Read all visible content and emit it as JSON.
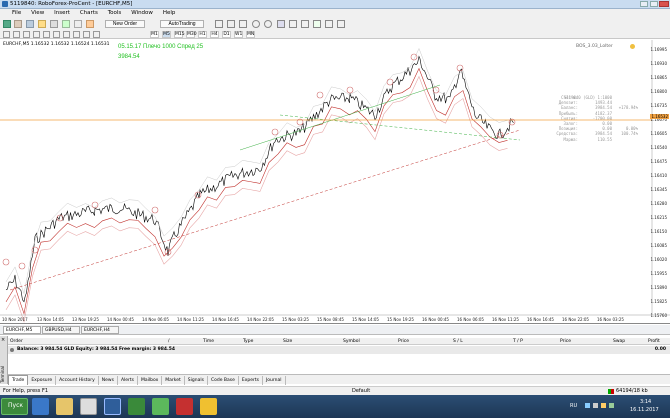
{
  "window": {
    "title": "5119840: RoboForex-ProCent - [EURCHF,M5]"
  },
  "menu": [
    "File",
    "View",
    "Insert",
    "Charts",
    "Tools",
    "Window",
    "Help"
  ],
  "toolbar": {
    "new_order": "New Order",
    "autotrading": "AutoTrading"
  },
  "timeframes": [
    "M1",
    "M5",
    "M15",
    "M30",
    "H1",
    "H4",
    "D1",
    "W1",
    "MN"
  ],
  "chart": {
    "symbol_info": "EURCHF,M5  1.16532 1.16532 1.16524 1.16531",
    "overlay_line1": "05.15.17 Плечо 1000 Спред 25",
    "overlay_line2": "3984.54",
    "ea_name": "BOS_3.03_Lolter",
    "y_ticks": [
      "1.16995",
      "1.16930",
      "1.16865",
      "1.16800",
      "1.16735",
      "1.16670",
      "1.16605",
      "1.16540",
      "1.16475",
      "1.16410",
      "1.16345",
      "1.16280",
      "1.16215",
      "1.16150",
      "1.16085",
      "1.16020",
      "1.15955",
      "1.15890",
      "1.15825",
      "1.15760"
    ],
    "current_price": "1.16532",
    "x_ticks": [
      "10 Nov 2017",
      "13 Nov 14:05",
      "13 Nov 19:25",
      "14 Nov 00:45",
      "14 Nov 06:05",
      "14 Nov 11:25",
      "14 Nov 16:45",
      "14 Nov 22:05",
      "15 Nov 03:25",
      "15 Nov 08:45",
      "15 Nov 14:05",
      "15 Nov 19:25",
      "16 Nov 00:45",
      "16 Nov 06:05",
      "16 Nov 11:25",
      "16 Nov 16:45",
      "16 Nov 22:05",
      "16 Nov 03:25"
    ]
  },
  "account_info": [
    {
      "k": "Счёт №:",
      "v": "5119840 (GLD) 1:1000",
      "p": ""
    },
    {
      "k": "Депозит:",
      "v": "1493.44",
      "p": ""
    },
    {
      "k": "Баланс:",
      "v": "3984.54",
      "p": "+178.94%"
    },
    {
      "k": "Прибыль:",
      "v": "4182.37",
      "p": ""
    },
    {
      "k": "Снятия:",
      "v": "-1700.00",
      "p": ""
    },
    {
      "k": "Залог:",
      "v": "0.00",
      "p": ""
    },
    {
      "k": "Позиция:",
      "v": "0.00",
      "p": "0.00%"
    },
    {
      "k": "Средства:",
      "v": "3984.54",
      "p": "100.74%"
    },
    {
      "k": "Маржа:",
      "v": "110.55",
      "p": ""
    }
  ],
  "symbol_tabs": [
    "EURCHF,M5",
    "GBPUSD,H4",
    "EURCHF,H4"
  ],
  "terminal": {
    "headers": [
      "Order",
      "/",
      "Time",
      "Type",
      "Size",
      "Symbol",
      "Price",
      "S / L",
      "T / P",
      "Price",
      "Swap",
      "Profit"
    ],
    "balance_row": "Balance: 3 984.54 GLD  Equity: 3 984.54  Free margin: 3 984.54",
    "balance_profit": "0.00",
    "tabs": [
      "Trade",
      "Exposure",
      "Account History",
      "News",
      "Alerts",
      "Mailbox",
      "Market",
      "Signals",
      "Code Base",
      "Experts",
      "Journal"
    ],
    "side_label": "Terminal"
  },
  "status": {
    "help": "For Help, press F1",
    "profile": "Default",
    "traffic": "64194/18 kb"
  },
  "taskbar": {
    "start": "Пуск",
    "lang": "RU",
    "time": "3:14",
    "date": "16.11.2017"
  },
  "colors": {
    "bullish": "#000000",
    "ma_red": "#c0302c",
    "ma_pink": "#e7a6a6",
    "trend_green": "#3cb043",
    "hline_orange": "#f0a040",
    "overlay_green": "#22c022",
    "accent_blue": "#2b4e74"
  }
}
